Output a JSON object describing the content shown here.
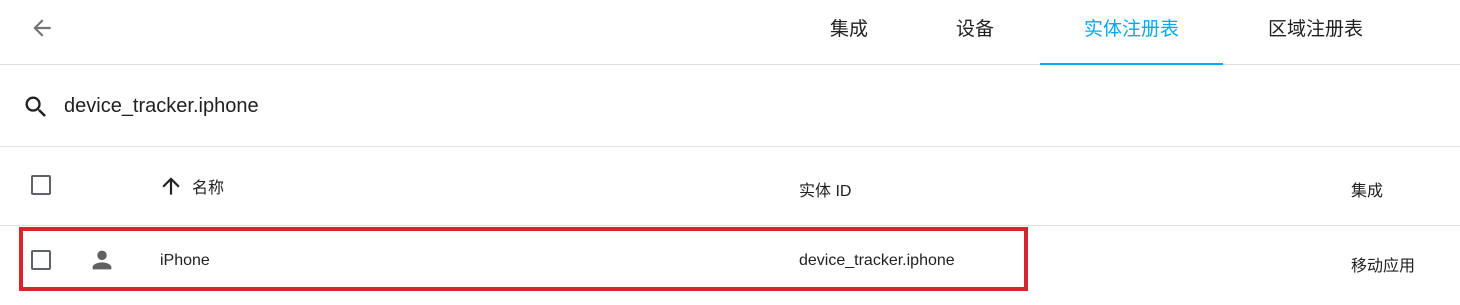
{
  "tabs": [
    {
      "label": "集成",
      "active": false
    },
    {
      "label": "设备",
      "active": false
    },
    {
      "label": "实体注册表",
      "active": true
    },
    {
      "label": "区域注册表",
      "active": false
    }
  ],
  "search": {
    "value": "device_tracker.iphone",
    "icon": "search-icon"
  },
  "table": {
    "columns": {
      "name": "名称",
      "entity_id": "实体 ID",
      "integration": "集成"
    },
    "sort": {
      "column": "name",
      "direction": "ascending",
      "icon": "arrow-up-icon"
    },
    "rows": [
      {
        "icon": "person-icon",
        "name": "iPhone",
        "entity_id": "device_tracker.iphone",
        "integration": "移动应用"
      }
    ]
  },
  "colors": {
    "accent": "#03a9f4",
    "highlight": "#d9232d",
    "divider": "#e0e0e0",
    "icon": "#5f6368"
  }
}
